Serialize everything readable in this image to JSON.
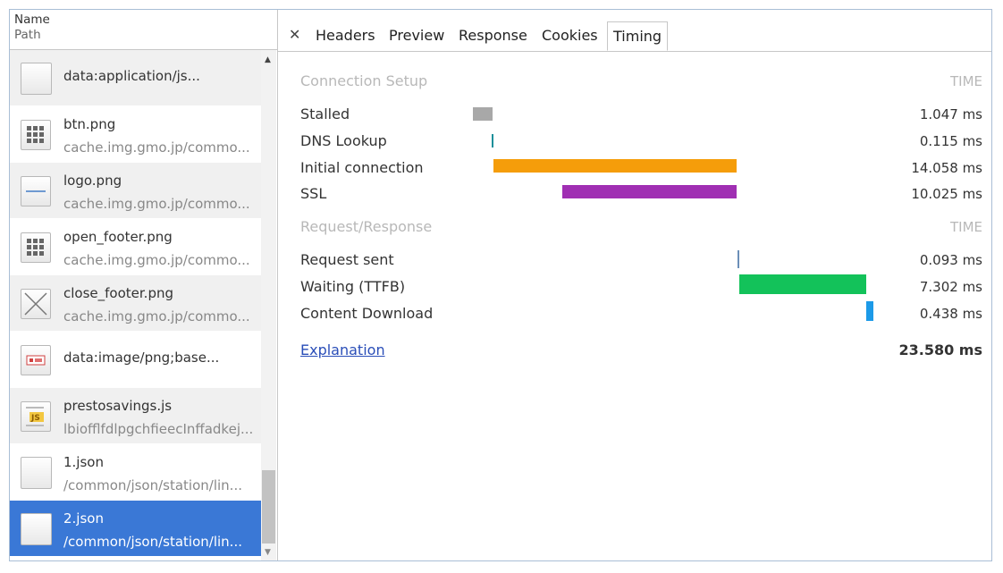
{
  "list_header": {
    "name": "Name",
    "path": "Path"
  },
  "requests": [
    {
      "name": "data:application/js...",
      "path": "",
      "icon": "blank-file-icon"
    },
    {
      "name": "btn.png",
      "path": "cache.img.gmo.jp/commo...",
      "icon": "grid-image-icon"
    },
    {
      "name": "logo.png",
      "path": "cache.img.gmo.jp/commo...",
      "icon": "logo-image-icon"
    },
    {
      "name": "open_footer.png",
      "path": "cache.img.gmo.jp/commo...",
      "icon": "grid-image-icon"
    },
    {
      "name": "close_footer.png",
      "path": "cache.img.gmo.jp/commo...",
      "icon": "x-image-icon"
    },
    {
      "name": "data:image/png;base...",
      "path": "",
      "icon": "data-image-icon"
    },
    {
      "name": "prestosavings.js",
      "path": "lbiofflfdlpgchfieecInffadkej...",
      "icon": "js-file-icon"
    },
    {
      "name": "1.json",
      "path": "/common/json/station/lin...",
      "icon": "blank-file-icon"
    },
    {
      "name": "2.json",
      "path": "/common/json/station/lin...",
      "icon": "blank-file-icon",
      "selected": true
    }
  ],
  "tabs": [
    {
      "label": "Headers"
    },
    {
      "label": "Preview"
    },
    {
      "label": "Response"
    },
    {
      "label": "Cookies"
    },
    {
      "label": "Timing",
      "active": true
    }
  ],
  "timing": {
    "connection_setup_title": "Connection Setup",
    "request_response_title": "Request/Response",
    "time_header": "TIME",
    "connection_rows": [
      {
        "label": "Stalled",
        "value": "1.047 ms",
        "color": "#a8a8a8"
      },
      {
        "label": "DNS Lookup",
        "value": "0.115 ms",
        "color": "#1b8f9a"
      },
      {
        "label": "Initial connection",
        "value": "14.058 ms",
        "color": "#f59d0a"
      },
      {
        "label": "SSL",
        "value": "10.025 ms",
        "color": "#a02fb3"
      }
    ],
    "request_rows": [
      {
        "label": "Request sent",
        "value": "0.093 ms",
        "color": "#6b8fb8"
      },
      {
        "label": "Waiting (TTFB)",
        "value": "7.302 ms",
        "color": "#13c25a"
      },
      {
        "label": "Content Download",
        "value": "0.438 ms",
        "color": "#1c9ae8"
      }
    ],
    "explanation_link": "Explanation",
    "total": "23.580 ms"
  }
}
